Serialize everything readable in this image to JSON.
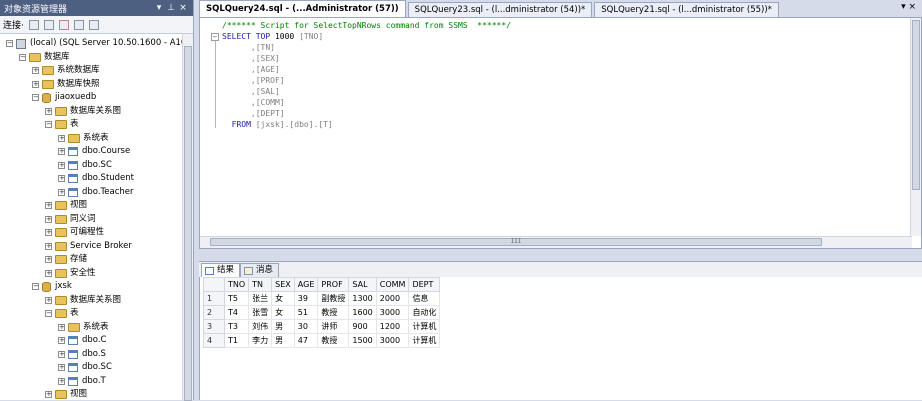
{
  "object_explorer": {
    "title": "对象资源管理器",
    "pin_label": "▾ ⊥ ×",
    "toolbar": {
      "connect_label": "连接·"
    },
    "tree": [
      {
        "label": "(local) (SQL Server 10.50.1600 - A105-00…",
        "icon": "server-icon",
        "depth": 0,
        "exp": "⊟"
      },
      {
        "label": "数据库",
        "icon": "folder-icon",
        "depth": 1,
        "exp": "⊟"
      },
      {
        "label": "系统数据库",
        "icon": "folder-icon",
        "depth": 2,
        "exp": "⊞"
      },
      {
        "label": "数据库快照",
        "icon": "folder-icon",
        "depth": 2,
        "exp": "⊞"
      },
      {
        "label": "jiaoxuedb",
        "icon": "database-icon",
        "depth": 2,
        "exp": "⊟"
      },
      {
        "label": "数据库关系图",
        "icon": "folder-icon",
        "depth": 3,
        "exp": "⊞"
      },
      {
        "label": "表",
        "icon": "folder-icon",
        "depth": 3,
        "exp": "⊟"
      },
      {
        "label": "系统表",
        "icon": "folder-icon",
        "depth": 4,
        "exp": "⊞"
      },
      {
        "label": "dbo.Course",
        "icon": "table-icon",
        "depth": 4,
        "exp": "⊞"
      },
      {
        "label": "dbo.SC",
        "icon": "table-icon",
        "depth": 4,
        "exp": "⊞"
      },
      {
        "label": "dbo.Student",
        "icon": "table-icon",
        "depth": 4,
        "exp": "⊞"
      },
      {
        "label": "dbo.Teacher",
        "icon": "table-icon",
        "depth": 4,
        "exp": "⊞"
      },
      {
        "label": "视图",
        "icon": "folder-icon",
        "depth": 3,
        "exp": "⊞"
      },
      {
        "label": "同义词",
        "icon": "folder-icon",
        "depth": 3,
        "exp": "⊞"
      },
      {
        "label": "可编程性",
        "icon": "folder-icon",
        "depth": 3,
        "exp": "⊞"
      },
      {
        "label": "Service Broker",
        "icon": "folder-icon",
        "depth": 3,
        "exp": "⊞"
      },
      {
        "label": "存储",
        "icon": "folder-icon",
        "depth": 3,
        "exp": "⊞"
      },
      {
        "label": "安全性",
        "icon": "folder-icon",
        "depth": 3,
        "exp": "⊞"
      },
      {
        "label": "jxsk",
        "icon": "database-icon",
        "depth": 2,
        "exp": "⊟"
      },
      {
        "label": "数据库关系图",
        "icon": "folder-icon",
        "depth": 3,
        "exp": "⊞"
      },
      {
        "label": "表",
        "icon": "folder-icon",
        "depth": 3,
        "exp": "⊟"
      },
      {
        "label": "系统表",
        "icon": "folder-icon",
        "depth": 4,
        "exp": "⊞"
      },
      {
        "label": "dbo.C",
        "icon": "table-icon",
        "depth": 4,
        "exp": "⊞"
      },
      {
        "label": "dbo.S",
        "icon": "table-icon",
        "depth": 4,
        "exp": "⊞"
      },
      {
        "label": "dbo.SC",
        "icon": "table-icon",
        "depth": 4,
        "exp": "⊞"
      },
      {
        "label": "dbo.T",
        "icon": "table-icon",
        "depth": 4,
        "exp": "⊞"
      },
      {
        "label": "视图",
        "icon": "folder-icon",
        "depth": 3,
        "exp": "⊞"
      }
    ]
  },
  "tabs": [
    {
      "label": "SQLQuery24.sql - (...Administrator (57))",
      "active": true
    },
    {
      "label": "SQLQuery23.sql - (l...dministrator (54))*",
      "active": false
    },
    {
      "label": "SQLQuery21.sql - (l...dministrator (55))*",
      "active": false
    }
  ],
  "tabs_right": "▾ ×",
  "editor": {
    "lines": [
      {
        "text": "/****** Script for SelectTopNRows command from SSMS  ******/",
        "cls": "cm"
      },
      {
        "text": "SELECT TOP 1000 [TNO]",
        "cls": "kw"
      },
      {
        "text": "      ,[TN]",
        "cls": "gr"
      },
      {
        "text": "      ,[SEX]",
        "cls": "gr"
      },
      {
        "text": "      ,[AGE]",
        "cls": "gr"
      },
      {
        "text": "      ,[PROF]",
        "cls": "gr"
      },
      {
        "text": "      ,[SAL]",
        "cls": "gr"
      },
      {
        "text": "      ,[COMM]",
        "cls": "gr"
      },
      {
        "text": "      ,[DEPT]",
        "cls": "gr"
      },
      {
        "text": "  FROM [jxsk].[dbo].[T]",
        "cls": "kw"
      }
    ],
    "hscroll_grip": "III"
  },
  "results_tabs": [
    {
      "label": "结果",
      "active": true
    },
    {
      "label": "消息",
      "active": false
    }
  ],
  "results": {
    "columns": [
      "TNO",
      "TN",
      "SEX",
      "AGE",
      "PROF",
      "SAL",
      "COMM",
      "DEPT"
    ],
    "rows": [
      [
        "1",
        "T5",
        "张兰",
        "女",
        "39",
        "副教授",
        "1300",
        "2000",
        "信息"
      ],
      [
        "2",
        "T4",
        "张雪",
        "女",
        "51",
        "教授",
        "1600",
        "3000",
        "自动化"
      ],
      [
        "3",
        "T3",
        "刘伟",
        "男",
        "30",
        "讲师",
        "900",
        "1200",
        "计算机"
      ],
      [
        "4",
        "T1",
        "李力",
        "男",
        "47",
        "教授",
        "1500",
        "3000",
        "计算机"
      ]
    ]
  }
}
